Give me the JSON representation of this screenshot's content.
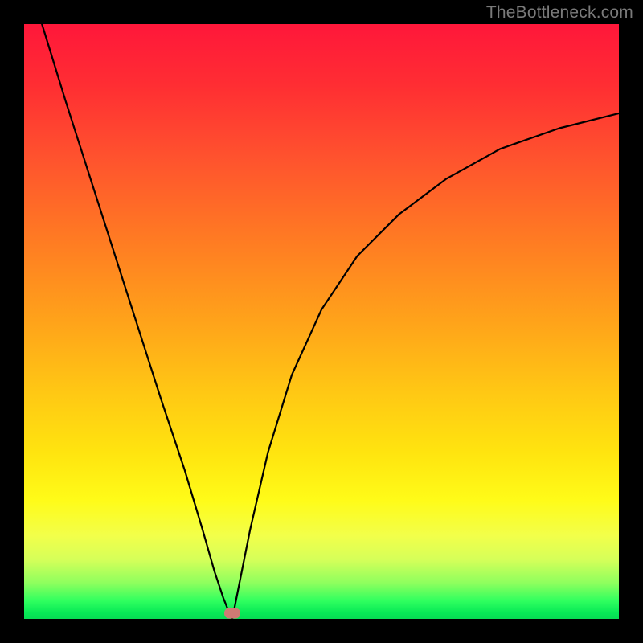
{
  "watermark": "TheBottleneck.com",
  "chart_data": {
    "type": "line",
    "title": "",
    "xlabel": "",
    "ylabel": "",
    "xlim": [
      0,
      1
    ],
    "ylim": [
      0,
      1
    ],
    "legend": false,
    "grid": false,
    "background_gradient": {
      "top": "#ff173a",
      "middle": "#ffe40f",
      "bottom": "#07dc54"
    },
    "series": [
      {
        "name": "left-branch",
        "x": [
          0.03,
          0.07,
          0.11,
          0.15,
          0.19,
          0.23,
          0.27,
          0.3,
          0.32,
          0.335,
          0.345,
          0.35
        ],
        "y": [
          1.0,
          0.87,
          0.745,
          0.62,
          0.495,
          0.37,
          0.25,
          0.15,
          0.08,
          0.035,
          0.01,
          0.0
        ]
      },
      {
        "name": "right-branch",
        "x": [
          0.35,
          0.36,
          0.38,
          0.41,
          0.45,
          0.5,
          0.56,
          0.63,
          0.71,
          0.8,
          0.9,
          1.0
        ],
        "y": [
          0.0,
          0.05,
          0.15,
          0.28,
          0.41,
          0.52,
          0.61,
          0.68,
          0.74,
          0.79,
          0.825,
          0.85
        ]
      }
    ],
    "marker": {
      "x": 0.35,
      "y": 0.01,
      "color": "#cf7a74"
    }
  }
}
